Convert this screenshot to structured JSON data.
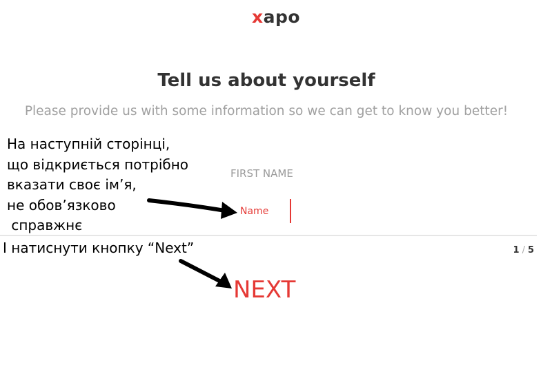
{
  "header": {
    "logo_x": "x",
    "logo_rest": "apo"
  },
  "main": {
    "title": "Tell us about yourself",
    "subtitle": "Please provide us with some information so we can get to know you better!",
    "first_name_label": "FIRST NAME",
    "first_name_placeholder": "Name"
  },
  "annotations": {
    "lines": [
      "На наступній сторінці,",
      "що відкриється потрібно",
      "вказати своє ім’я,",
      "не обов’язково",
      " справжнє"
    ],
    "next_hint": "І натиснути кнопку “Next”"
  },
  "footer": {
    "current_step": "1",
    "separator": "/",
    "total_steps": "5",
    "next_label": "NEXT"
  },
  "colors": {
    "accent": "#e53935",
    "text": "#333333",
    "muted": "#a0a0a0"
  }
}
